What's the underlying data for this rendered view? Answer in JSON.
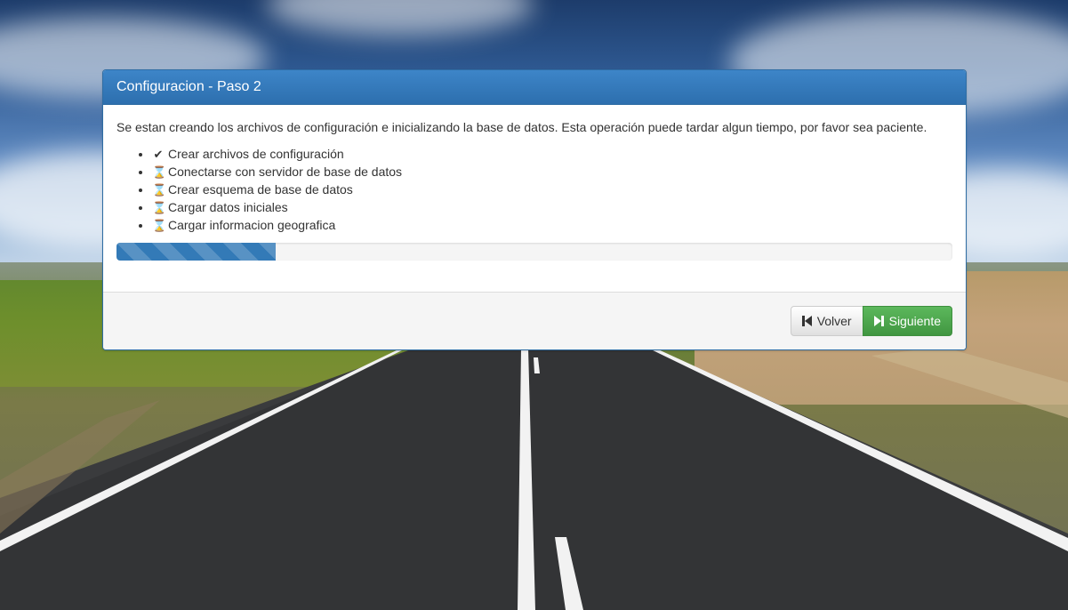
{
  "panel": {
    "title": "Configuracion - Paso 2",
    "intro": "Se estan creando los archivos de configuración e inicializando la base de datos. Esta operación puede tardar algun tiempo, por favor sea paciente.",
    "steps": [
      {
        "icon": "check-icon",
        "glyph": "✔",
        "label": "Crear archivos de configuración",
        "status": "done"
      },
      {
        "icon": "hourglass-icon",
        "glyph": "⌛",
        "label": "Conectarse con servidor de base de datos",
        "status": "pending"
      },
      {
        "icon": "hourglass-icon",
        "glyph": "⌛",
        "label": "Crear esquema de base de datos",
        "status": "pending"
      },
      {
        "icon": "hourglass-icon",
        "glyph": "⌛",
        "label": "Cargar datos iniciales",
        "status": "pending"
      },
      {
        "icon": "hourglass-icon",
        "glyph": "⌛",
        "label": "Cargar informacion geografica",
        "status": "pending"
      }
    ],
    "progress_percent": 19
  },
  "footer": {
    "back_label": "Volver",
    "back_icon": "step-backward-icon",
    "next_label": "Siguiente",
    "next_icon": "step-forward-icon"
  },
  "colors": {
    "primary": "#337ab7",
    "success": "#5cb85c",
    "heading": "#2d6fae"
  }
}
